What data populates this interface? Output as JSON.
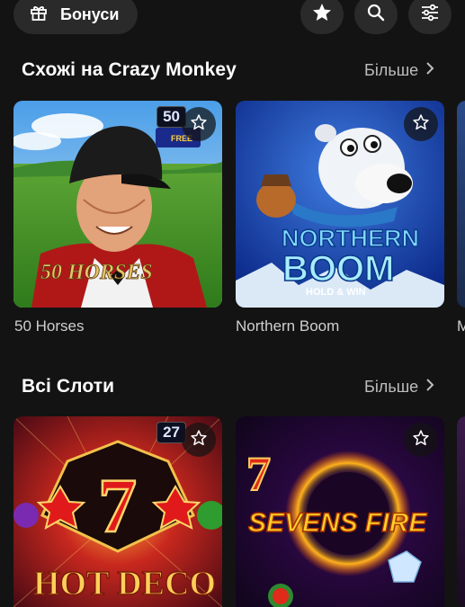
{
  "topbar": {
    "bonus_label": "Бонуси",
    "icons": [
      "gift-icon",
      "star-icon",
      "search-icon",
      "filter-icon"
    ]
  },
  "sections": [
    {
      "title": "Схожі на Crazy Monkey",
      "more_label": "Більше",
      "games": [
        {
          "name": "50 Horses",
          "badge": "50",
          "logo_text": "50 HORSES",
          "extra_badge": "FREE SPINS"
        },
        {
          "name": "Northern Boom",
          "logo_line1": "NORTHERN",
          "logo_line2": "BOOM",
          "logo_line3": "HOLD & WIN"
        },
        {
          "name": "M"
        }
      ]
    },
    {
      "title": "Всі Слоти",
      "more_label": "Більше",
      "games": [
        {
          "name": "Hot Deco",
          "badge": "27",
          "logo_text": "HOT DECO"
        },
        {
          "name": "Sevens Fire",
          "logo_text": "SEVENS FIRE"
        }
      ]
    }
  ],
  "colors": {
    "background": "#131313",
    "button_bg": "#2a2a2a",
    "more_text": "#bdbdbd",
    "game_name_text": "#cfcfcf"
  }
}
